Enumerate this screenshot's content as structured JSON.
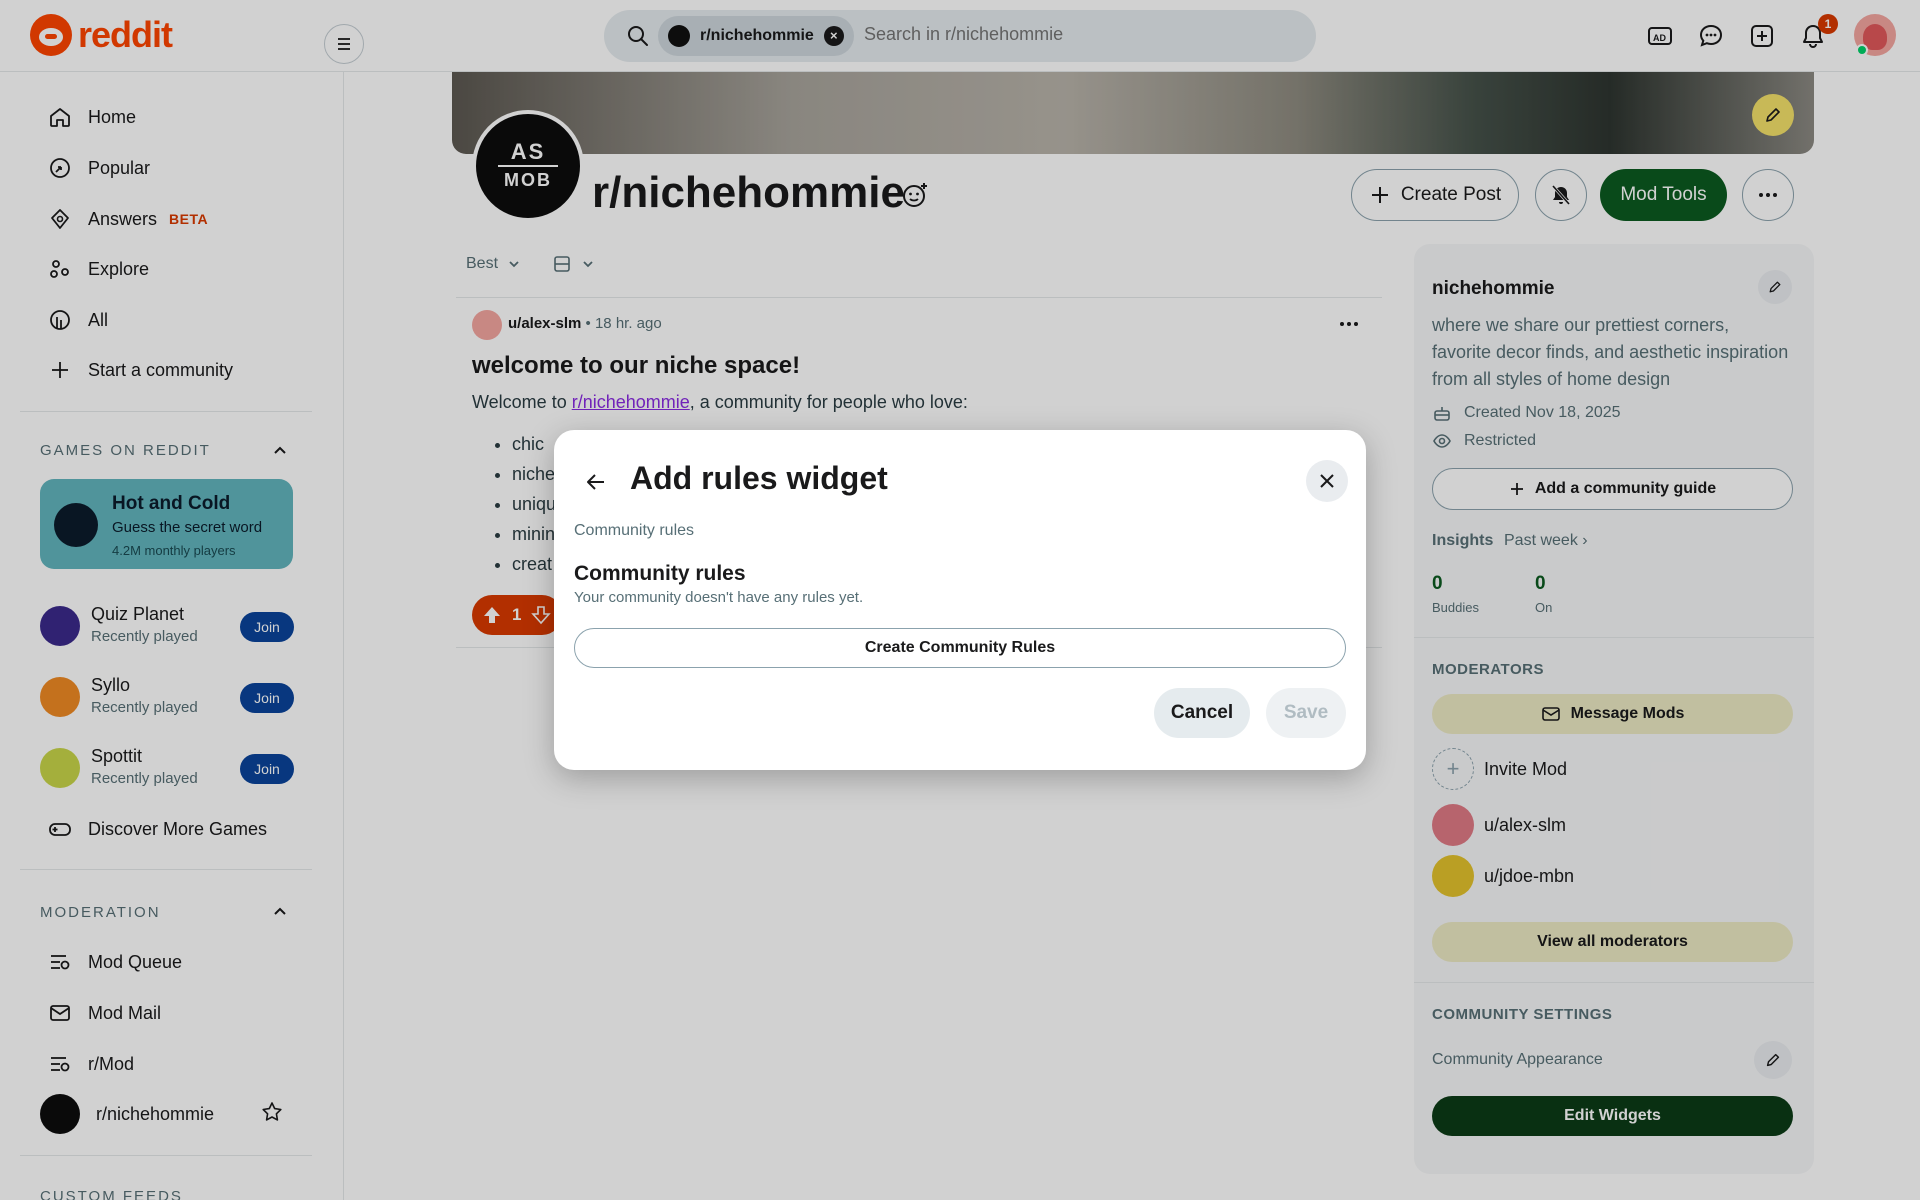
{
  "header": {
    "logo_text": "reddit",
    "search_chip": "r/nichehommie",
    "search_placeholder": "Search in r/nichehommie",
    "icons": [
      "advertise-icon",
      "chat-icon",
      "create-icon",
      "bell-icon"
    ],
    "notification_count": "1"
  },
  "sidebar": {
    "nav": [
      {
        "label": "Home",
        "icon": "home-icon"
      },
      {
        "label": "Popular",
        "icon": "popular-icon"
      },
      {
        "label": "Answers",
        "badge": "BETA",
        "icon": "answers-icon"
      },
      {
        "label": "Explore",
        "icon": "explore-icon"
      },
      {
        "label": "All",
        "icon": "all-icon"
      },
      {
        "label": "Start a community",
        "icon": "plus-icon"
      }
    ],
    "games_title": "GAMES ON REDDIT",
    "featured_game": {
      "title": "Hot and Cold",
      "subtitle": "Guess the secret word",
      "meta": "4.2M monthly players"
    },
    "games": [
      {
        "name": "Quiz Planet",
        "sub": "Recently played",
        "join": "Join"
      },
      {
        "name": "Syllo",
        "sub": "Recently played",
        "join": "Join"
      },
      {
        "name": "Spottit",
        "sub": "Recently played",
        "join": "Join"
      }
    ],
    "discover": "Discover More Games",
    "moderation_title": "MODERATION",
    "moderation": [
      {
        "label": "Mod Queue"
      },
      {
        "label": "Mod Mail"
      },
      {
        "label": "r/Mod"
      },
      {
        "label": "r/nichehommie"
      }
    ],
    "custom_feeds_title": "CUSTOM FEEDS"
  },
  "community": {
    "avatar_text_top": "AS",
    "avatar_text_bottom": "MOB",
    "name": "r/nichehommie",
    "create_post": "Create Post",
    "mod_tools": "Mod Tools"
  },
  "feed": {
    "sort": "Best",
    "post": {
      "author": "u/alex-slm",
      "time": "18 hr. ago",
      "title": "welcome to our niche space!",
      "body_prefix": "Welcome to ",
      "body_link": "r/nichehommie",
      "body_suffix": ", a community for people who love:",
      "bullets": [
        "chic",
        "niche",
        "uniqu",
        "minin",
        "creat"
      ],
      "votes": "1"
    }
  },
  "about": {
    "title": "nichehommie",
    "description": "where we share our prettiest corners, favorite decor finds, and aesthetic inspiration from all styles of home design",
    "created": "Created Nov 18, 2025",
    "visibility": "Restricted",
    "guide_button": "Add a community guide",
    "insights": "Insights",
    "insights_period": "Past week",
    "stats": [
      {
        "value": "0",
        "label": "Buddies"
      },
      {
        "value": "0",
        "label": "On"
      }
    ],
    "moderators_title": "MODERATORS",
    "message_mods": "Message Mods",
    "invite_mod": "Invite Mod",
    "mods": [
      "u/alex-slm",
      "u/jdoe-mbn"
    ],
    "view_all_mods": "View all moderators",
    "settings_title": "COMMUNITY SETTINGS",
    "appearance": "Community Appearance",
    "edit_widgets": "Edit Widgets"
  },
  "modal": {
    "title": "Add rules widget",
    "subtitle": "Community rules",
    "heading": "Community rules",
    "description": "Your community doesn't have any rules yet.",
    "create_button": "Create Community Rules",
    "cancel": "Cancel",
    "save": "Save"
  },
  "colors": {
    "brand": "#ff4500",
    "mod_green": "#0b5b20",
    "join_blue": "#0a449b",
    "vote_orange": "#d93a00"
  }
}
